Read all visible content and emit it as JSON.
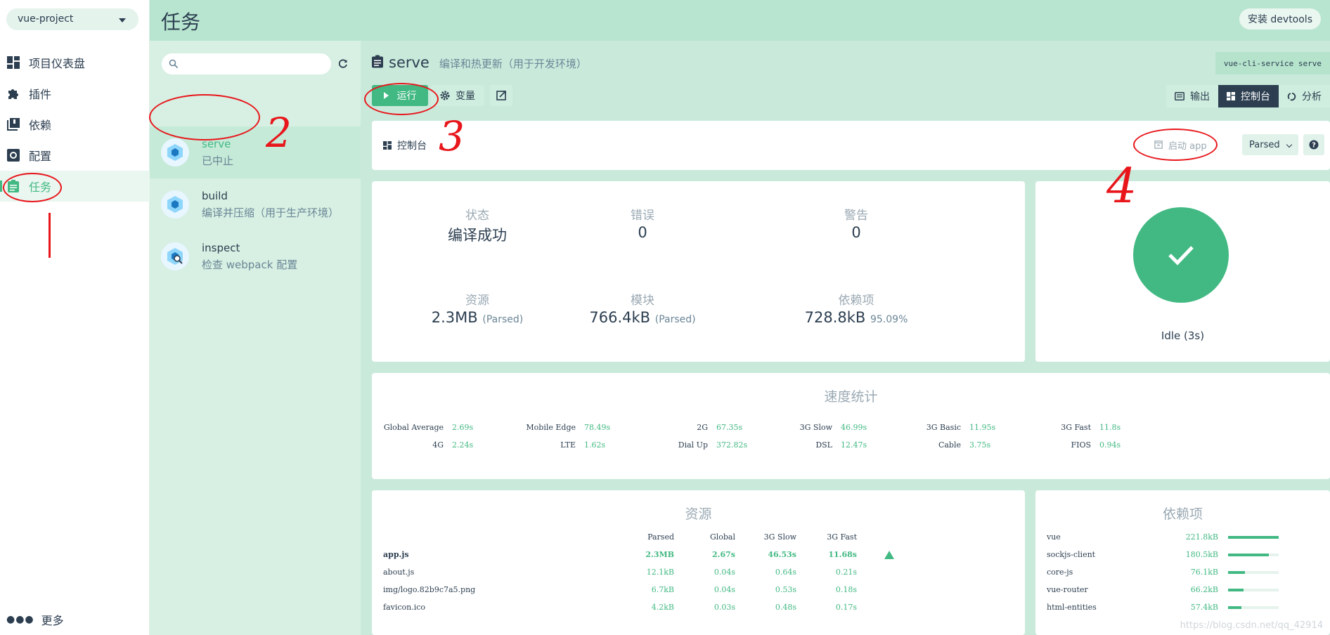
{
  "nav": {
    "project": "vue-project",
    "items": [
      {
        "label": "项目仪表盘",
        "icon": "dashboard-icon"
      },
      {
        "label": "插件",
        "icon": "puzzle-icon"
      },
      {
        "label": "依赖",
        "icon": "library-books-icon"
      },
      {
        "label": "配置",
        "icon": "settings-applications-icon"
      },
      {
        "label": "任务",
        "icon": "assignment-icon"
      }
    ],
    "more": "更多"
  },
  "header": {
    "title": "任务",
    "devtools": "安装 devtools"
  },
  "tasks": [
    {
      "name": "serve",
      "desc": "已中止"
    },
    {
      "name": "build",
      "desc": "编译并压缩（用于生产环境）"
    },
    {
      "name": "inspect",
      "desc": "检查 webpack 配置"
    }
  ],
  "task_detail": {
    "name": "serve",
    "desc": "编译和热更新（用于开发环境）",
    "command": "vue-cli-service serve",
    "run": "运行",
    "vars": "变量",
    "tabs": [
      "输出",
      "控制台",
      "分析"
    ]
  },
  "dashboard": {
    "label": "控制台",
    "open_app": "启动 app",
    "mode": "Parsed",
    "stats": {
      "status_label": "状态",
      "status_value": "编译成功",
      "errors_label": "错误",
      "errors_value": "0",
      "warnings_label": "警告",
      "warnings_value": "0",
      "assets_label": "资源",
      "assets_value": "2.3MB",
      "assets_note": "(Parsed)",
      "modules_label": "模块",
      "modules_value": "766.4kB",
      "modules_note": "(Parsed)",
      "deps_label": "依赖项",
      "deps_value": "728.8kB",
      "deps_note": "95.09%"
    },
    "status_text": "Idle (3s)",
    "speed": {
      "title": "速度统计",
      "rows": [
        [
          [
            "Global Average",
            "2.69s"
          ],
          [
            "Mobile Edge",
            "78.49s"
          ],
          [
            "2G",
            "67.35s"
          ],
          [
            "3G Slow",
            "46.99s"
          ],
          [
            "3G Basic",
            "11.95s"
          ],
          [
            "3G Fast",
            "11.8s"
          ]
        ],
        [
          [
            "4G",
            "2.24s"
          ],
          [
            "LTE",
            "1.62s"
          ],
          [
            "Dial Up",
            "372.82s"
          ],
          [
            "DSL",
            "12.47s"
          ],
          [
            "Cable",
            "3.75s"
          ],
          [
            "FIOS",
            "0.94s"
          ]
        ]
      ]
    },
    "assets": {
      "title": "资源",
      "headers": [
        "Parsed",
        "Global",
        "3G Slow",
        "3G Fast"
      ],
      "rows": [
        {
          "name": "app.js",
          "values": [
            "2.3MB",
            "2.67s",
            "46.53s",
            "11.68s"
          ]
        },
        {
          "name": "about.js",
          "values": [
            "12.1kB",
            "0.04s",
            "0.64s",
            "0.21s"
          ]
        },
        {
          "name": "img/logo.82b9c7a5.png",
          "values": [
            "6.7kB",
            "0.04s",
            "0.53s",
            "0.18s"
          ]
        },
        {
          "name": "favicon.ico",
          "values": [
            "4.2kB",
            "0.03s",
            "0.48s",
            "0.17s"
          ]
        }
      ]
    },
    "deps": {
      "title": "依赖项",
      "rows": [
        {
          "name": "vue",
          "size": "221.8kB",
          "fraction": 1.0
        },
        {
          "name": "sockjs-client",
          "size": "180.5kB",
          "fraction": 0.81
        },
        {
          "name": "core-js",
          "size": "76.1kB",
          "fraction": 0.34
        },
        {
          "name": "vue-router",
          "size": "66.2kB",
          "fraction": 0.3
        },
        {
          "name": "html-entities",
          "size": "57.4kB",
          "fraction": 0.26
        }
      ]
    }
  },
  "annotations": [
    "2",
    "3",
    "4"
  ],
  "watermark": "https://blog.csdn.net/qq_42914",
  "colors": {
    "accent": "#42b983",
    "dark": "#2c3e50",
    "annotation": "#e8161b"
  }
}
